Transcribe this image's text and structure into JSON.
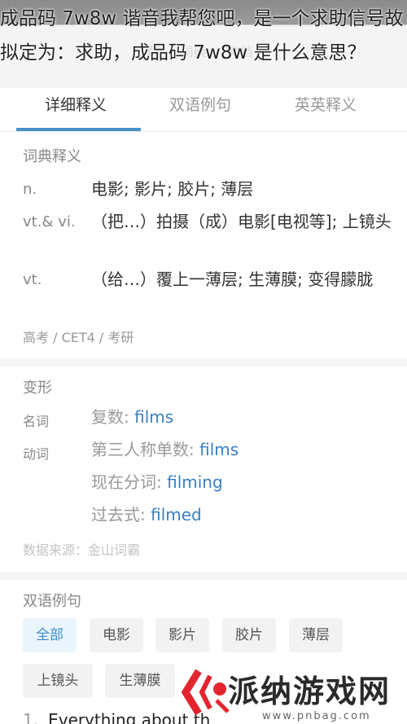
{
  "overlay": {
    "title": "成品码 7w8w 谐音我帮您吧，是一个求助信号故拟定为：求助，成品码 7w8w 是什么意思？"
  },
  "tabs": [
    {
      "label": "详细释义"
    },
    {
      "label": "双语例句"
    },
    {
      "label": "英英释义"
    }
  ],
  "dictionary": {
    "heading": "词典释义",
    "senses": [
      {
        "pos": "n.",
        "def": "电影; 影片; 胶片; 薄层"
      },
      {
        "pos": "vt.& vi.",
        "def": "（把…）拍摄（成）电影[电视等]; 上镜头"
      },
      {
        "pos": "vt.",
        "def": "（给…）覆上一薄层; 生薄膜; 变得朦胧"
      }
    ],
    "levels": "高考 / CET4 / 考研"
  },
  "inflections": {
    "heading": "变形",
    "noun_tag": "名词",
    "verb_tag": "动词",
    "rows": [
      {
        "label": "复数: ",
        "word": "films"
      },
      {
        "label": "第三人称单数: ",
        "word": "films"
      },
      {
        "label": "现在分词: ",
        "word": "filming"
      },
      {
        "label": "过去式: ",
        "word": "filmed"
      }
    ],
    "source": "数据来源：金山词霸"
  },
  "examples": {
    "heading": "双语例句",
    "chips": [
      "全部",
      "电影",
      "影片",
      "胶片",
      "薄层",
      "上镜头",
      "生薄膜"
    ],
    "first_number": "1.",
    "first_sentence": "Everything about th"
  },
  "watermark": {
    "text": "派纳游戏网",
    "url": "www.pnbag.com"
  },
  "colors": {
    "accent": "#4a90c8",
    "link": "#3a7fc4"
  }
}
